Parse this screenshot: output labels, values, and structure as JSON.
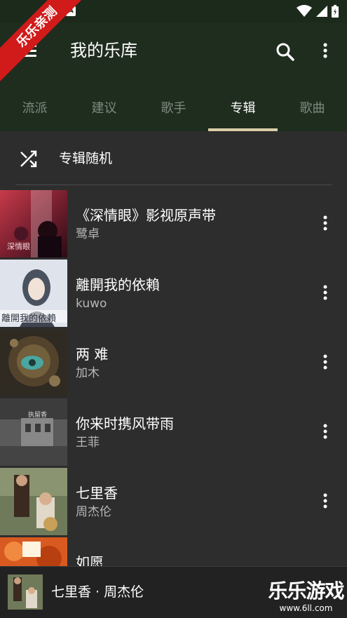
{
  "status_bar": {
    "a_badge": "A"
  },
  "app_bar": {
    "title": "我的乐库",
    "tabs": [
      {
        "label": "流派"
      },
      {
        "label": "建议"
      },
      {
        "label": "歌手"
      },
      {
        "label": "专辑",
        "active": true
      },
      {
        "label": "歌曲"
      }
    ]
  },
  "shuffle": {
    "label": "专辑随机"
  },
  "albums": [
    {
      "title": "《深情眼》影视原声带",
      "artist": "鹭卓"
    },
    {
      "title": "離開我的依賴",
      "artist": "kuwo"
    },
    {
      "title": "两 难",
      "artist": "加木"
    },
    {
      "title": "你来时携风带雨",
      "artist": "王菲"
    },
    {
      "title": "七里香",
      "artist": "周杰伦"
    },
    {
      "title": "如愿",
      "artist": ""
    }
  ],
  "now_playing": {
    "text": "七里香 · 周杰伦"
  },
  "badge": {
    "text": "乐乐亲测"
  },
  "watermark": {
    "main": "乐乐游戏",
    "sub": "www.6ll.com"
  },
  "colors": {
    "app_bar": "#1f2d1f",
    "status_bar": "#1c2a1c",
    "background": "#2d2d2d",
    "tab_indicator": "#d9cfa8",
    "badge": "#d11a1a"
  },
  "icons": [
    "menu-icon",
    "search-icon",
    "more-vert-icon",
    "shuffle-icon",
    "wifi-icon",
    "signal-icon",
    "battery-icon"
  ]
}
